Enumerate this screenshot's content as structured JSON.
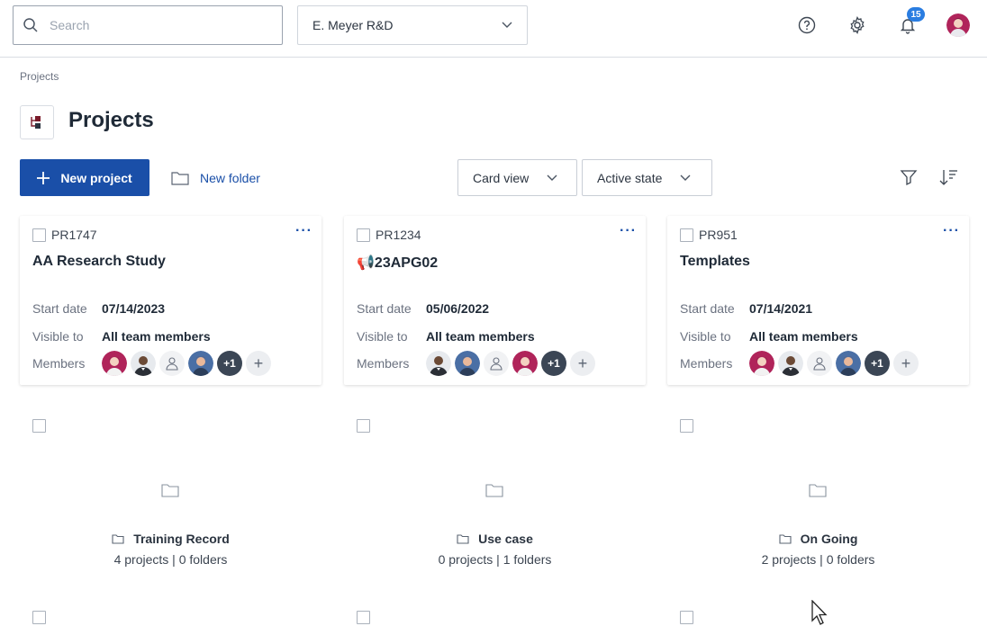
{
  "topbar": {
    "search_placeholder": "Search",
    "org_name": "E. Meyer R&D",
    "notification_count": "15"
  },
  "header": {
    "breadcrumb": "Projects",
    "title": "Projects",
    "new_project_label": "New project",
    "new_folder_label": "New folder",
    "view_select": "Card view",
    "state_select": "Active state"
  },
  "labels": {
    "start_date": "Start date",
    "visible_to": "Visible to",
    "members": "Members",
    "more_members": "+1"
  },
  "cards": [
    {
      "code": "PR1747",
      "name": "AA Research Study",
      "start_date": "07/14/2023",
      "visible_to": "All team members"
    },
    {
      "code": "PR1234",
      "name": "📢23APG02",
      "start_date": "05/06/2022",
      "visible_to": "All team members"
    },
    {
      "code": "PR951",
      "name": "Templates",
      "start_date": "07/14/2021",
      "visible_to": "All team members"
    }
  ],
  "folders": [
    {
      "name": "Training Record",
      "count": "4 projects | 0 folders"
    },
    {
      "name": "Use case",
      "count": "0 projects | 1 folders"
    },
    {
      "name": "On Going",
      "count": "2 projects | 0 folders"
    }
  ],
  "colors": {
    "primary": "#1a4fa8",
    "badge": "#2a7de1",
    "avatar_pink": "#b0245a",
    "avatar_dark": "#3b4655",
    "avatar_blue": "#4a6fa5"
  }
}
